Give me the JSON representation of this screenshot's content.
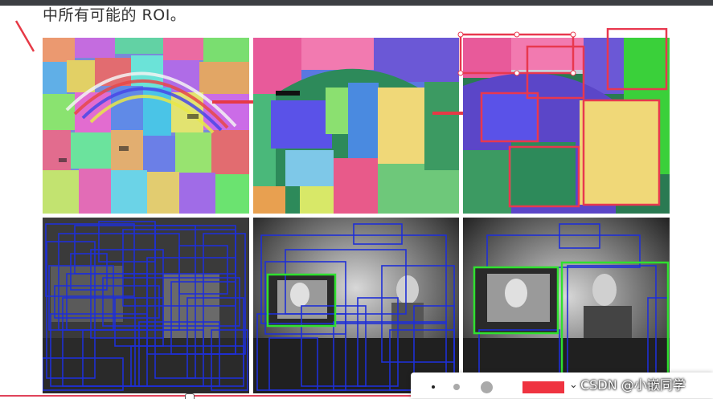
{
  "heading": "中所有可能的 ROI。",
  "watermark": "CSDN @小嵌同学",
  "toolbar": {
    "pen_sizes": [
      "small-dot-icon",
      "medium-dot-icon",
      "large-dot-icon"
    ],
    "pen_color": "#ef3340"
  },
  "colors": {
    "box_red": "#e8384f",
    "box_blue": "#1f2fd6",
    "box_green": "#2fe02f",
    "arrow_red": "#e63946"
  }
}
